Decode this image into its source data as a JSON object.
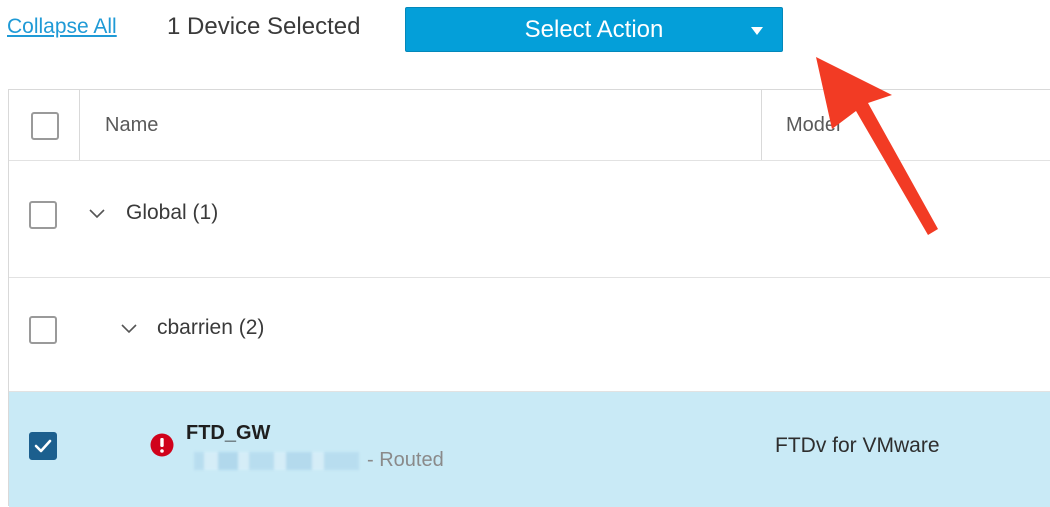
{
  "toolbar": {
    "collapse_label": "Collapse All",
    "selected_count": "1 Device Selected",
    "action_label": "Select Action"
  },
  "table": {
    "columns": [
      "Name",
      "Model"
    ],
    "groups": [
      {
        "label": "Global (1)"
      },
      {
        "label": "cbarrien (2)"
      }
    ],
    "device": {
      "name": "FTD_GW",
      "mode": "- Routed",
      "model": "FTDv for VMware",
      "checked": true,
      "status": "error"
    }
  },
  "icons": {
    "checkbox": "checkbox-icon",
    "chevron": "chevron-down-icon",
    "error": "error-icon",
    "caret": "caret-down-icon"
  },
  "colors": {
    "action_button": "#049fd9",
    "link": "#1f9ad6",
    "selected_row": "#c9eaf6",
    "error": "#d0021b",
    "annotation_arrow": "#f23b24"
  }
}
